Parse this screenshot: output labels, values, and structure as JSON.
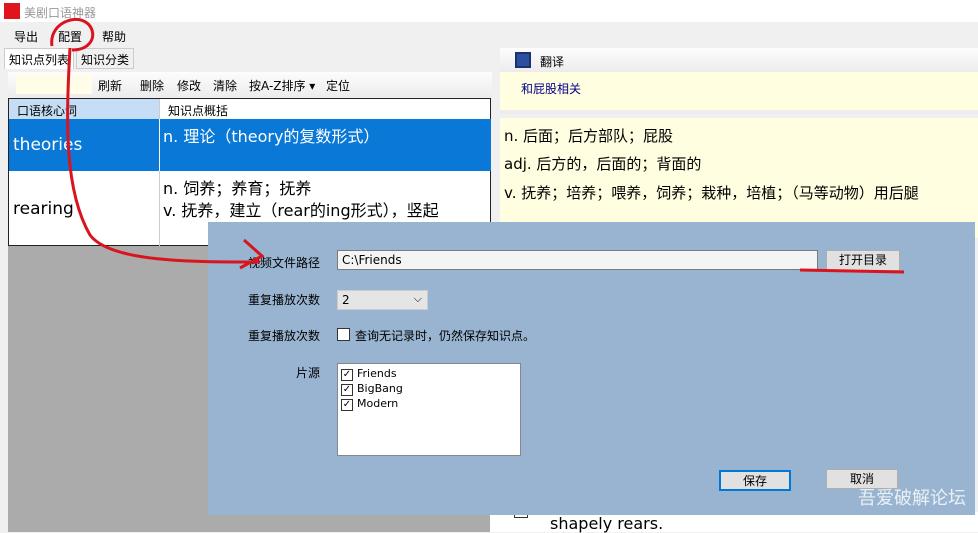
{
  "window": {
    "title": "美剧口语神器"
  },
  "menu": [
    "导出",
    "配置",
    "帮助"
  ],
  "tabs": [
    "知识点列表",
    "知识分类"
  ],
  "left_toolbar": [
    "刷新",
    "删除",
    "修改",
    "清除",
    "按A-Z排序 ▾",
    "定位"
  ],
  "grid": {
    "headers": [
      "口语核心词",
      "知识点概括"
    ],
    "rows": [
      {
        "word": "theories",
        "summary": "n. 理论（theory的复数形式）",
        "selected": true
      },
      {
        "word": "rearing",
        "summary": "n. 饲养；养育；抚养",
        "summary2": "v. 抚养，建立（rear的ing形式），竖起"
      }
    ]
  },
  "right_toolbar": {
    "translate": "翻译"
  },
  "related": "和屁股相关",
  "definitions": [
    "n. 后面；后方部队；屁股",
    "adj. 后方的，后面的；背面的",
    "v. 抚养；培养；喂养，饲养；栽种，培植；（马等动物）用后腿"
  ],
  "background_text": "shapely rears.",
  "dialog": {
    "path_label": "视频文件路径",
    "path_value": "C:\\Friends",
    "open_dir": "打开目录",
    "repeat_label": "重复播放次数",
    "repeat_value": "2",
    "repeat_label2": "重复播放次数",
    "save_checkbox_label": "查询无记录时，仍然保存知识点。",
    "save_checked": false,
    "source_label": "片源",
    "sources": [
      {
        "name": "Friends",
        "checked": true
      },
      {
        "name": "BigBang",
        "checked": true
      },
      {
        "name": "Modern",
        "checked": true
      }
    ],
    "save": "保存",
    "cancel": "取消"
  },
  "watermark": "吾爱破解论坛",
  "colors": {
    "selection": "#0a78d7",
    "dialog_bg": "#98b4d0",
    "definition_bg": "#fffee0",
    "annotation": "#d9141e"
  }
}
